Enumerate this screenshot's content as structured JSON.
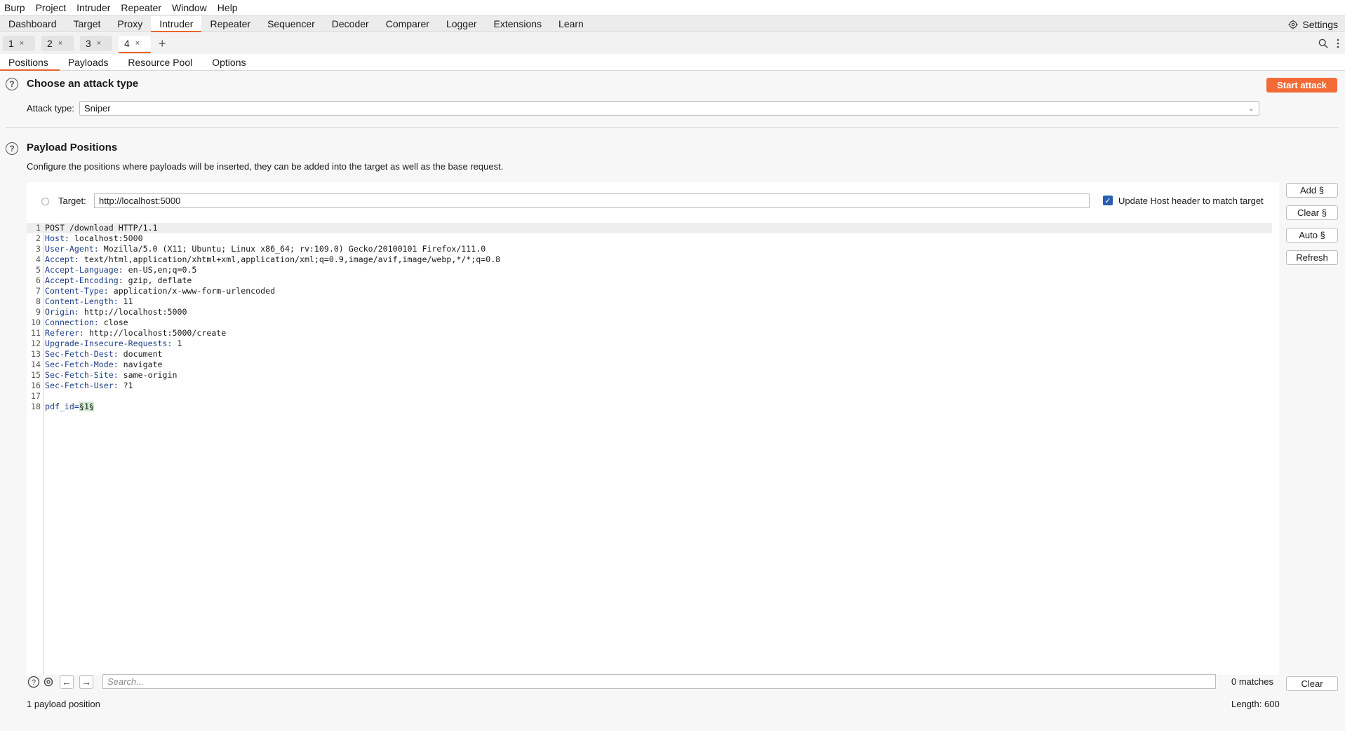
{
  "menu": [
    "Burp",
    "Project",
    "Intruder",
    "Repeater",
    "Window",
    "Help"
  ],
  "main_tabs": [
    "Dashboard",
    "Target",
    "Proxy",
    "Intruder",
    "Repeater",
    "Sequencer",
    "Decoder",
    "Comparer",
    "Logger",
    "Extensions",
    "Learn"
  ],
  "active_main_tab": "Intruder",
  "settings_label": "Settings",
  "instance_tabs": [
    "1",
    "2",
    "3",
    "4"
  ],
  "instance_close": "×",
  "instance_add": "+",
  "sub_tabs": [
    "Positions",
    "Payloads",
    "Resource Pool",
    "Options"
  ],
  "attack_section": {
    "title": "Choose an attack type",
    "start_label": "Start attack",
    "type_label": "Attack type:",
    "type_value": "Sniper"
  },
  "payload_section": {
    "title": "Payload Positions",
    "description": "Configure the positions where payloads will be inserted, they can be added into the target as well as the base request."
  },
  "target": {
    "label": "Target:",
    "value": "http://localhost:5000",
    "update_host_label": "Update Host header to match target",
    "update_host_checked": true
  },
  "side_buttons": [
    "Add §",
    "Clear §",
    "Auto §",
    "Refresh"
  ],
  "request_lines": [
    {
      "n": "1",
      "name": "",
      "value": "POST /download HTTP/1.1"
    },
    {
      "n": "2",
      "name": "Host:",
      "value": " localhost:5000"
    },
    {
      "n": "3",
      "name": "User-Agent:",
      "value": " Mozilla/5.0 (X11; Ubuntu; Linux x86_64; rv:109.0) Gecko/20100101 Firefox/111.0"
    },
    {
      "n": "4",
      "name": "Accept:",
      "value": " text/html,application/xhtml+xml,application/xml;q=0.9,image/avif,image/webp,*/*;q=0.8"
    },
    {
      "n": "5",
      "name": "Accept-Language:",
      "value": " en-US,en;q=0.5"
    },
    {
      "n": "6",
      "name": "Accept-Encoding:",
      "value": " gzip, deflate"
    },
    {
      "n": "7",
      "name": "Content-Type:",
      "value": " application/x-www-form-urlencoded"
    },
    {
      "n": "8",
      "name": "Content-Length:",
      "value": " 11"
    },
    {
      "n": "9",
      "name": "Origin:",
      "value": " http://localhost:5000"
    },
    {
      "n": "10",
      "name": "Connection:",
      "value": " close"
    },
    {
      "n": "11",
      "name": "Referer:",
      "value": " http://localhost:5000/create"
    },
    {
      "n": "12",
      "name": "Upgrade-Insecure-Requests:",
      "value": " 1"
    },
    {
      "n": "13",
      "name": "Sec-Fetch-Dest:",
      "value": " document"
    },
    {
      "n": "14",
      "name": "Sec-Fetch-Mode:",
      "value": " navigate"
    },
    {
      "n": "15",
      "name": "Sec-Fetch-Site:",
      "value": " same-origin"
    },
    {
      "n": "16",
      "name": "Sec-Fetch-User:",
      "value": " ?1"
    },
    {
      "n": "17",
      "name": "",
      "value": ""
    },
    {
      "n": "18",
      "name": "pdf_id=",
      "value": "",
      "marker": "§1§"
    }
  ],
  "search": {
    "placeholder": "Search...",
    "matches": "0 matches",
    "clear_label": "Clear"
  },
  "footer": {
    "positions": "1 payload position",
    "length": "Length: 600"
  },
  "colors": {
    "accent": "#e8632b",
    "start_button": "#f26b36",
    "header_name": "#1d3f8a",
    "checkbox": "#2a5fb0"
  }
}
